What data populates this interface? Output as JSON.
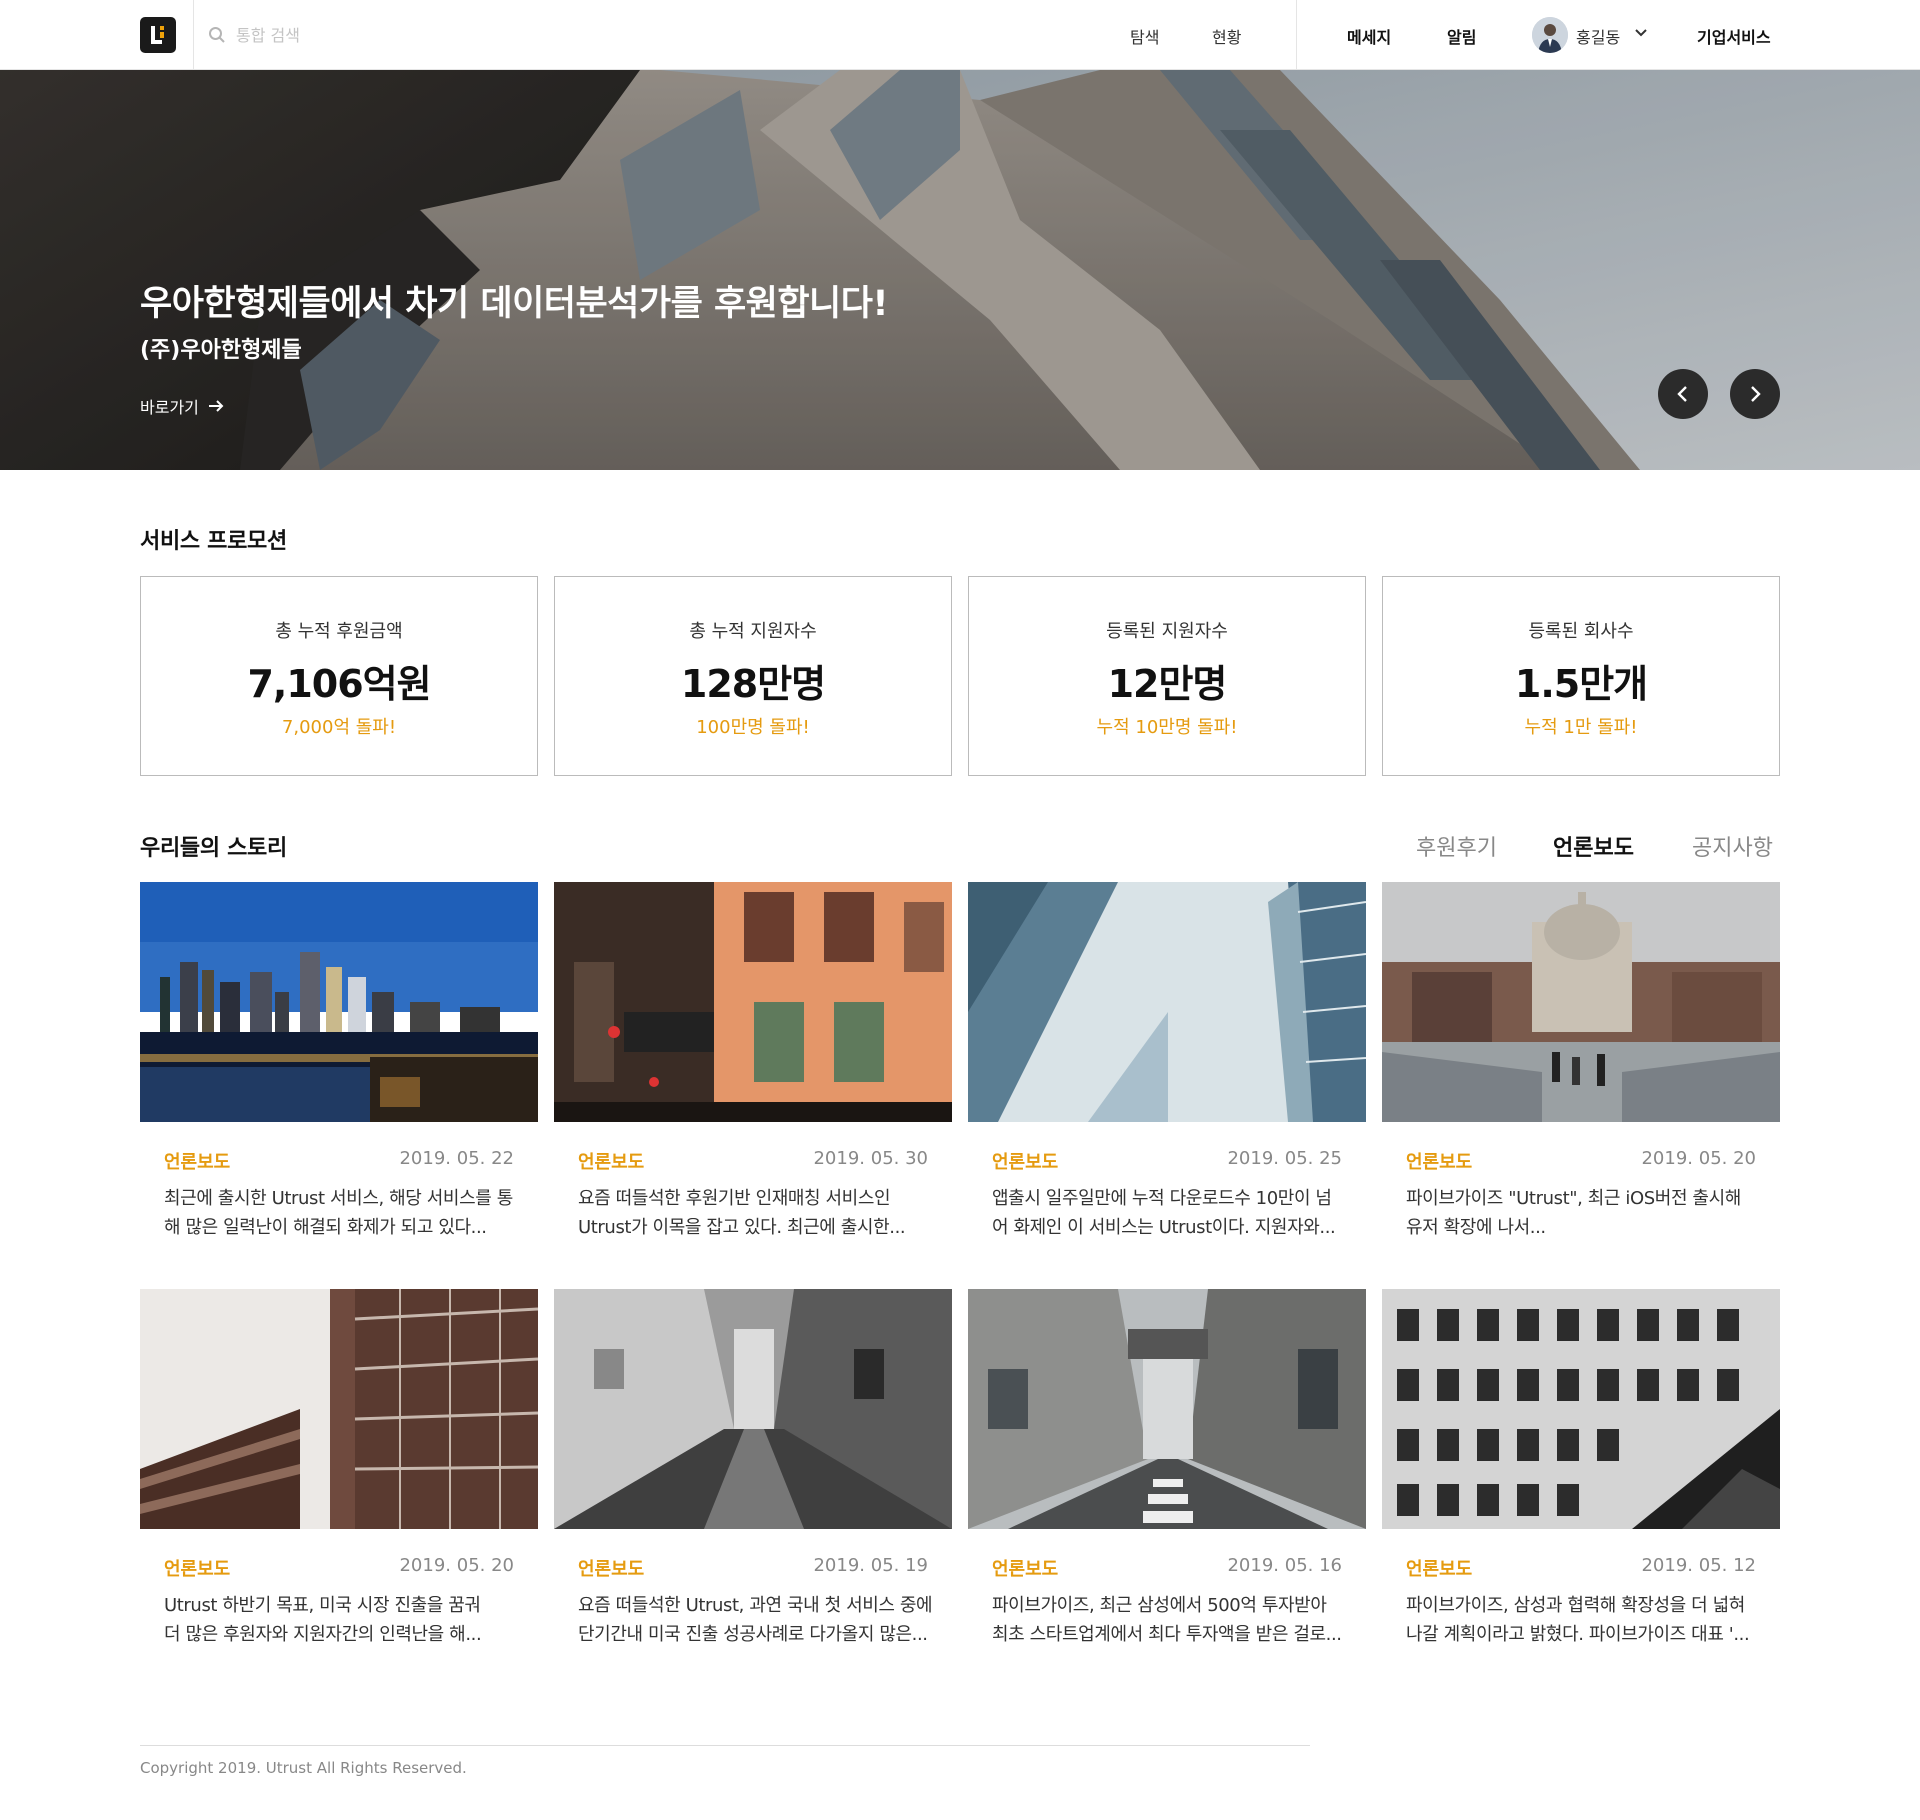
{
  "header": {
    "search_placeholder": "통합 검색",
    "nav": [
      "탐색",
      "현황"
    ],
    "message_label": "메세지",
    "alert_label": "알림",
    "user_name": "홍길동",
    "enterprise_label": "기업서비스"
  },
  "hero": {
    "title": "우아한형제들에서 차기 데이터분석가를 후원합니다!",
    "company": "(주)우아한형제들",
    "link_label": "바로가기"
  },
  "promotion": {
    "title": "서비스 프로모션",
    "stats": [
      {
        "label": "총 누적 후원금액",
        "value": "7,106억원",
        "note": "7,000억 돌파!"
      },
      {
        "label": "총 누적 지원자수",
        "value": "128만명",
        "note": "100만명 돌파!"
      },
      {
        "label": "등록된 지원자수",
        "value": "12만명",
        "note": "누적 10만명 돌파!"
      },
      {
        "label": "등록된 회사수",
        "value": "1.5만개",
        "note": "누적 1만 돌파!"
      }
    ]
  },
  "stories": {
    "title": "우리들의 스토리",
    "tabs": [
      "후원후기",
      "언론보도",
      "공지사항"
    ],
    "active_tab": "언론보도",
    "cards": [
      {
        "category": "언론보도",
        "date": "2019. 05. 22",
        "line1": "최근에 출시한 Utrust 서비스, 해당 서비스를 통",
        "line2": "해 많은 일력난이 해결되 화제가 되고 있다..."
      },
      {
        "category": "언론보도",
        "date": "2019. 05. 30",
        "line1": "요즘 떠들석한 후원기반 인재매칭 서비스인",
        "line2": "Utrust가 이목을 잡고 있다. 최근에 출시한..."
      },
      {
        "category": "언론보도",
        "date": "2019. 05. 25",
        "line1": "앱출시 일주일만에 누적 다운로드수 10만이 넘",
        "line2": "어 화제인 이 서비스는 Utrust이다. 지원자와..."
      },
      {
        "category": "언론보도",
        "date": "2019. 05. 20",
        "line1": "파이브가이즈 \"Utrust\", 최근 iOS버전 출시해",
        "line2": "유저 확장에 나서..."
      },
      {
        "category": "언론보도",
        "date": "2019. 05. 20",
        "line1": "Utrust 하반기 목표, 미국 시장 진출을 꿈궈",
        "line2": "더 많은 후원자와 지원자간의 인력난을 해..."
      },
      {
        "category": "언론보도",
        "date": "2019. 05. 19",
        "line1": "요즘 떠들석한 Utrust, 과연 국내 첫 서비스 중에",
        "line2": "단기간내 미국 진출 성공사례로 다가올지 많은..."
      },
      {
        "category": "언론보도",
        "date": "2019. 05. 16",
        "line1": "파이브가이즈, 최근 삼성에서 500억 투자받아",
        "line2": "최초 스타트업계에서 최다 투자액을 받은 걸로..."
      },
      {
        "category": "언론보도",
        "date": "2019. 05. 12",
        "line1": "파이브가이즈, 삼성과 협력해 확장성을 더 넓혀",
        "line2": "나갈 계획이라고 밝혔다. 파이브가이즈 대표 '..."
      }
    ]
  },
  "footer": {
    "copyright": "Copyright 2019. Utrust All Rights Reserved."
  },
  "colors": {
    "accent": "#e59b10",
    "dark": "#111111"
  }
}
